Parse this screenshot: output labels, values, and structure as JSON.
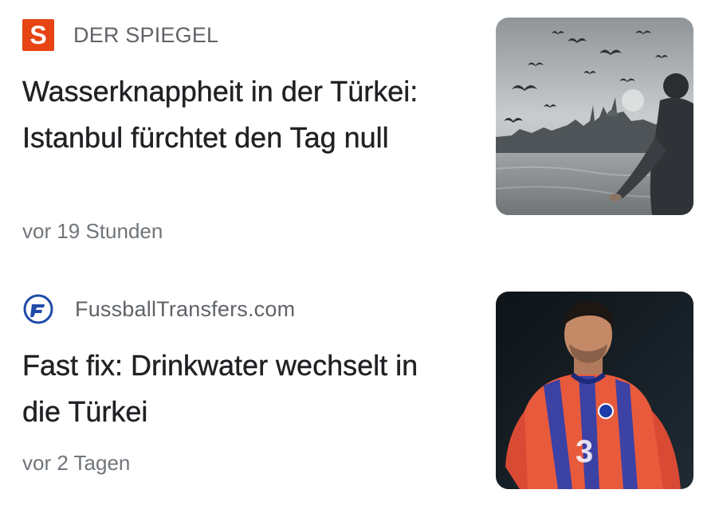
{
  "articles": [
    {
      "source": "DER SPIEGEL",
      "logo_letter": "S",
      "logo_icon": "spiegel-logo-icon",
      "headline": "Wasserknappheit in der Türkei: Istanbul fürchtet den Tag null",
      "time": "vor 19 Stunden",
      "thumbnail": "istanbul-seagulls-thumbnail",
      "accent_color": "#e64415"
    },
    {
      "source": "FussballTransfers.com",
      "logo_icon": "fussballtransfers-logo-icon",
      "headline": "Fast fix: Drinkwater wechselt in die Türkei",
      "time": "vor 2 Tagen",
      "thumbnail": "football-player-thumbnail",
      "accent_color": "#1f4aa8"
    }
  ]
}
